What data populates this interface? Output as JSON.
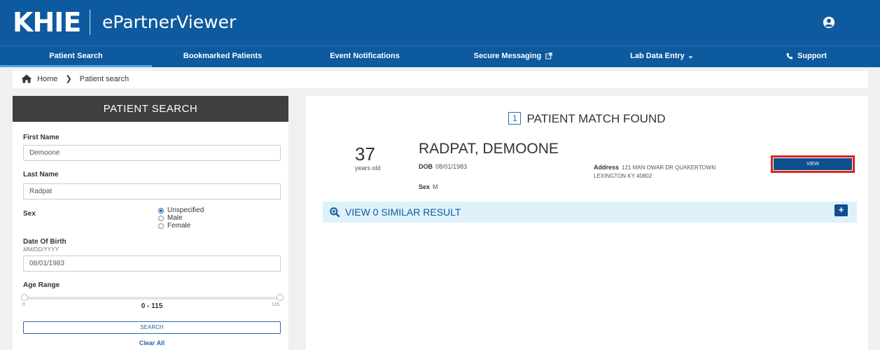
{
  "header": {
    "logo": "KHIE",
    "app_title": "ePartnerViewer"
  },
  "nav": {
    "items": [
      {
        "label": "Patient Search"
      },
      {
        "label": "Bookmarked Patients"
      },
      {
        "label": "Event Notifications"
      },
      {
        "label": "Secure Messaging"
      },
      {
        "label": "Lab Data Entry"
      },
      {
        "label": "Support"
      }
    ],
    "active_index": 0
  },
  "breadcrumb": {
    "home": "Home",
    "current": "Patient search"
  },
  "search_panel": {
    "title": "PATIENT SEARCH",
    "first_name_label": "First Name",
    "first_name_value": "Demoone",
    "last_name_label": "Last Name",
    "last_name_value": "Radpat",
    "sex_label": "Sex",
    "sex_options": [
      "Unspecified",
      "Male",
      "Female"
    ],
    "sex_selected": "Unspecified",
    "dob_label": "Date Of Birth",
    "dob_format": "MM/DD/YYYY",
    "dob_value": "08/01/1983",
    "age_range_label": "Age Range",
    "age_min": "0",
    "age_max": "115",
    "age_range_text": "0 - 115",
    "search_button": "SEARCH",
    "clear_link": "Clear All"
  },
  "results": {
    "count": "1",
    "heading": "PATIENT MATCH FOUND",
    "patient": {
      "age": "37",
      "age_unit": "years old",
      "name": "RADPAT, DEMOONE",
      "dob_label": "DOB",
      "dob": "08/01/1983",
      "sex_label": "Sex",
      "sex": "M",
      "address_label": "Address",
      "address_line1": "121 MAN OWAR DR QUAKERTOWN",
      "address_line2": "LEXINGTON KY 40802"
    },
    "view_button": "VIEW",
    "similar_text": "VIEW 0 SIMILAR RESULT",
    "expand_label": "+"
  },
  "colors": {
    "header_bg": "#0e5a9e",
    "panel_head_bg": "#3f3f3f",
    "view_button_bg": "#0e4f8e",
    "highlight_border": "#e0201e",
    "similar_bar_bg": "#def1fa"
  }
}
